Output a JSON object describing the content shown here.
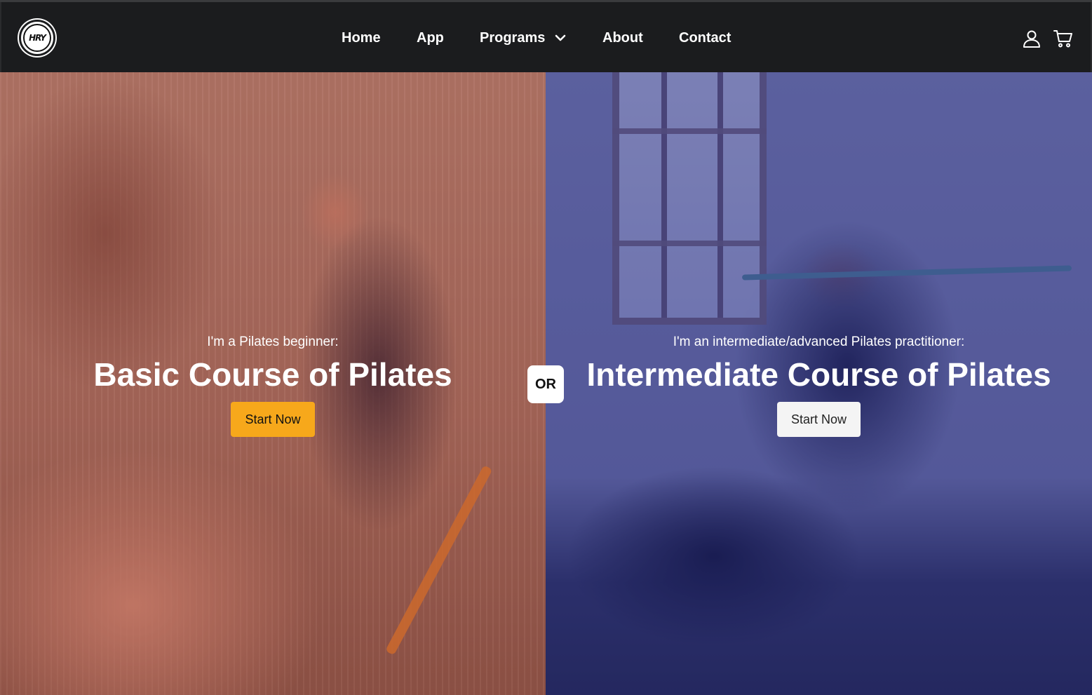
{
  "brand": {
    "logo_text": "HRY"
  },
  "nav": {
    "items": [
      {
        "label": "Home"
      },
      {
        "label": "App"
      },
      {
        "label": "Programs"
      },
      {
        "label": "About"
      },
      {
        "label": "Contact"
      }
    ],
    "icons": [
      "user-icon",
      "cart-icon",
      "chevron-down-icon"
    ]
  },
  "hero": {
    "left": {
      "eyebrow": "I'm a Pilates beginner:",
      "title": "Basic Course of Pilates",
      "cta": "Start Now",
      "cta_color": "#f7a81b"
    },
    "separator": "OR",
    "right": {
      "eyebrow": "I'm an intermediate/advanced Pilates practitioner:",
      "title": "Intermediate Course of Pilates",
      "cta": "Start Now",
      "cta_color": "#f4f4f4"
    }
  },
  "colors": {
    "header_bg": "#1b1c1e",
    "left_tint": "#963c32",
    "right_tint": "#1e1e6e"
  }
}
